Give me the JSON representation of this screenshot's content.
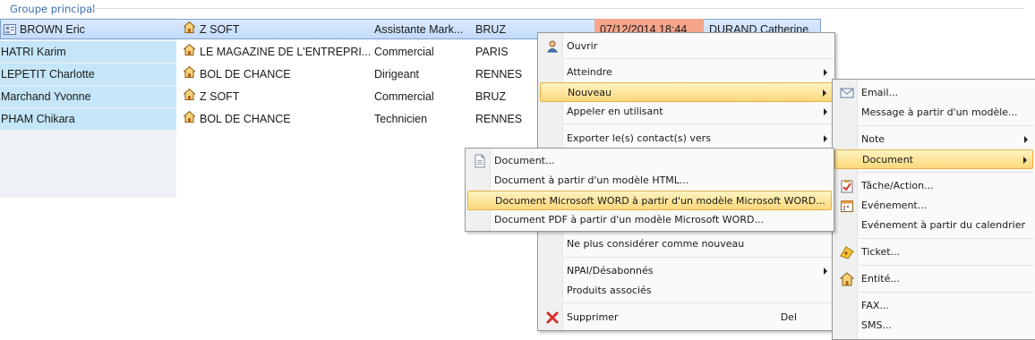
{
  "group": {
    "label": "Groupe principal"
  },
  "rows": [
    {
      "name": "BROWN Eric",
      "company": "Z SOFT",
      "job": "Assistante Mark...",
      "city": "BRUZ",
      "date": "07/12/2014 18:44",
      "owner": "DURAND Catherine"
    },
    {
      "name": "HATRI Karim",
      "company": "LE MAGAZINE DE L'ENTREPRI...",
      "job": "Commercial",
      "city": "PARIS"
    },
    {
      "name": "LEPETIT Charlotte",
      "company": "BOL DE CHANCE",
      "job": "Dirigeant",
      "city": "RENNES"
    },
    {
      "name": "Marchand Yvonne",
      "company": "Z SOFT",
      "job": "Commercial",
      "city": "BRUZ"
    },
    {
      "name": "PHAM Chikara",
      "company": "BOL DE CHANCE",
      "job": "Technicien",
      "city": "RENNES"
    }
  ],
  "context_menu": {
    "open": "Ouvrir",
    "goto": "Atteindre",
    "new": "Nouveau",
    "call_using": "Appeler en utilisant",
    "export": "Exporter le(s) contact(s) vers",
    "not_new": "Ne plus considérer comme nouveau",
    "npai": "NPAI/Désabonnés",
    "products": "Produits associés",
    "delete": "Supprimer",
    "delete_shortcut": "Del"
  },
  "nouveau_menu": {
    "email": "Email...",
    "message_template": "Message à partir d'un modèle...",
    "note": "Note",
    "document": "Document",
    "task": "Tâche/Action...",
    "event": "Evénement...",
    "event_calendar": "Evénement à partir du calendrier",
    "ticket": "Ticket...",
    "entity": "Entité...",
    "fax": "FAX...",
    "sms": "SMS..."
  },
  "document_menu": {
    "document": "Document...",
    "html_template": "Document à partir d'un modèle HTML...",
    "word_template": "Document Microsoft WORD à partir d'un modèle Microsoft WORD...",
    "pdf_template": "Document PDF à partir d'un modèle Microsoft WORD..."
  },
  "colors": {
    "highlight": "#fbd87a",
    "selection": "#c1dbfc",
    "date_bg": "#f4a58a",
    "group_label": "#3c6eb4"
  }
}
